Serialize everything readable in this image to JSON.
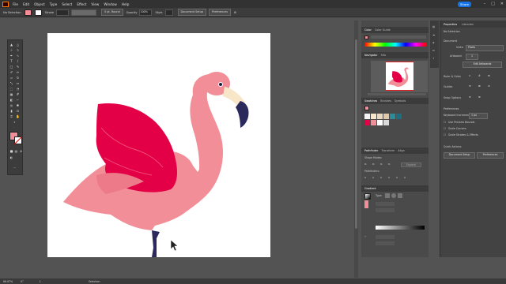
{
  "menubar": {
    "items": [
      "File",
      "Edit",
      "Object",
      "Type",
      "Select",
      "Effect",
      "View",
      "Window",
      "Help"
    ],
    "share_label": "Share"
  },
  "control_bar": {
    "selection_label": "No Selection",
    "fill_color": "#f28e98",
    "stroke_label": "Stroke",
    "brush_label": "5 pt. Round",
    "opacity_label": "Opacity",
    "opacity_value": "100%",
    "style_label": "Style",
    "doc_setup_label": "Document Setup",
    "preferences_label": "Preferences"
  },
  "color_panel": {
    "tabs": [
      "Color",
      "Color Guide"
    ]
  },
  "navigator_panel": {
    "tabs": [
      "Navigator",
      "Info"
    ]
  },
  "swatches_panel": {
    "tabs": [
      "Swatches",
      "Brushes",
      "Symbols"
    ],
    "swatch_colors": [
      "#f4f4f4",
      "#f7e7c8",
      "#e8d9c0",
      "#e1c8a8",
      "#2a8c9a",
      "#1e6d80",
      "#e40046",
      "#f28e98",
      "#ffffff",
      "#d9d9d9"
    ]
  },
  "pathfinder_panel": {
    "tabs": [
      "Pathfinder",
      "Transform",
      "Align"
    ],
    "shape_modes_label": "Shape Modes:",
    "pathfinders_label": "Pathfinders:",
    "expand_label": "Expand"
  },
  "gradient_panel": {
    "tabs": [
      "Gradient"
    ],
    "type_label": "Type:"
  },
  "properties_panel": {
    "tabs": [
      "Properties",
      "Libraries"
    ],
    "no_selection": "No Selection",
    "document_label": "Document",
    "units_label": "Units:",
    "units_value": "Pixels",
    "artboard_label": "Artboard:",
    "artboard_value": "1",
    "edit_artboards_label": "Edit Artboards",
    "rulers_label": "Ruler & Grids",
    "guides_label": "Guides",
    "snap_label": "Snap Options",
    "preferences_label": "Preferences",
    "keyboard_increment_label": "Keyboard Increment:",
    "keyboard_increment_value": "1 px",
    "preview_bounds_label": "Use Preview Bounds",
    "scale_corners_label": "Scale Corners",
    "scale_strokes_label": "Scale Strokes & Effects",
    "quick_actions_label": "Quick Actions",
    "doc_setup_btn": "Document Setup",
    "preferences_btn": "Preferences"
  },
  "status": {
    "zoom": "66.67%",
    "rotation": "0°",
    "artboard": "1",
    "tool": "Selection"
  },
  "artwork": {
    "body_color": "#f28e98",
    "wing_color": "#e40046",
    "beak_color": "#f7e7c8",
    "beak_tip_color": "#2c2a5c",
    "leg_color": "#2c2a5c"
  }
}
